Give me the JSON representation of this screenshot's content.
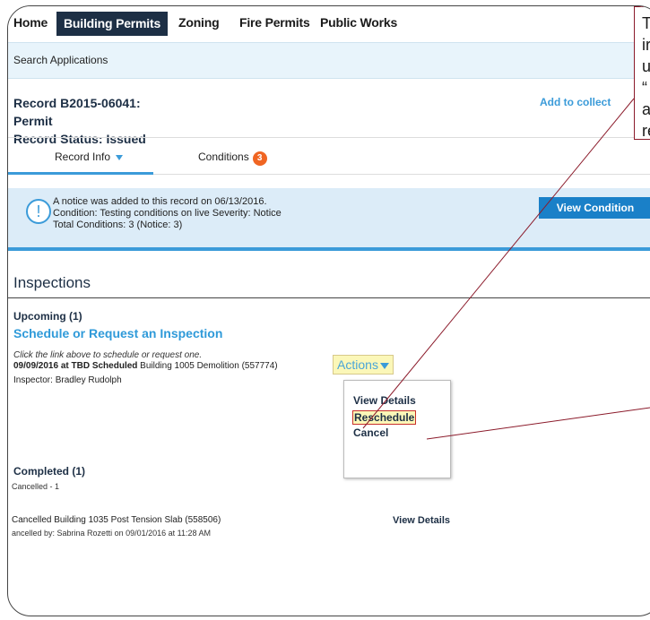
{
  "nav": {
    "items": [
      "Home",
      "Building Permits",
      "Zoning",
      "Fire Permits",
      "Public Works"
    ],
    "active_index": 1
  },
  "search": {
    "label": "Search Applications"
  },
  "record": {
    "line1": "Record B2015-06041:",
    "line2": "Permit",
    "line3": "Record Status: Issued",
    "add_collection": "Add to collect"
  },
  "tabs": {
    "record_info": "Record Info",
    "conditions": "Conditions",
    "conditions_count": "3"
  },
  "notice": {
    "line1": "A notice was added to this record on 06/13/2016.",
    "line2": "Condition: Testing conditions on live   Severity: Notice",
    "line3": "Total Conditions: 3 (Notice: 3)",
    "button": "View Condition"
  },
  "inspections": {
    "title": "Inspections",
    "upcoming": "Upcoming (1)",
    "schedule_link": "Schedule or Request an Inspection",
    "hint": "Click the link above to schedule or request one.",
    "insp_bold": "09/09/2016 at TBD Scheduled",
    "insp_rest": " Building 1005 Demolition (557774)",
    "inspector": "Inspector: Bradley Rudolph",
    "actions": "Actions",
    "menu": [
      "View Details",
      "Reschedule",
      "Cancel"
    ],
    "completed": "Completed (1)",
    "cancelled_count": "Cancelled - 1",
    "cancel_bold": "Cancelled",
    "cancel_rest": " Building 1035 Post Tension Slab (558506)",
    "cancel_by": "ancelled by: Sabrina Rozetti on 09/01/2016 at 11:28 AM",
    "view_details": "View Details"
  },
  "callout": {
    "lines": [
      "T",
      "ir",
      "u",
      "“",
      "a",
      "re"
    ]
  },
  "colors": {
    "accent": "#3b9bd9",
    "nav_dark": "#1d2f45",
    "highlight": "#fbf7b8",
    "callout_border": "#8b1a2a"
  }
}
